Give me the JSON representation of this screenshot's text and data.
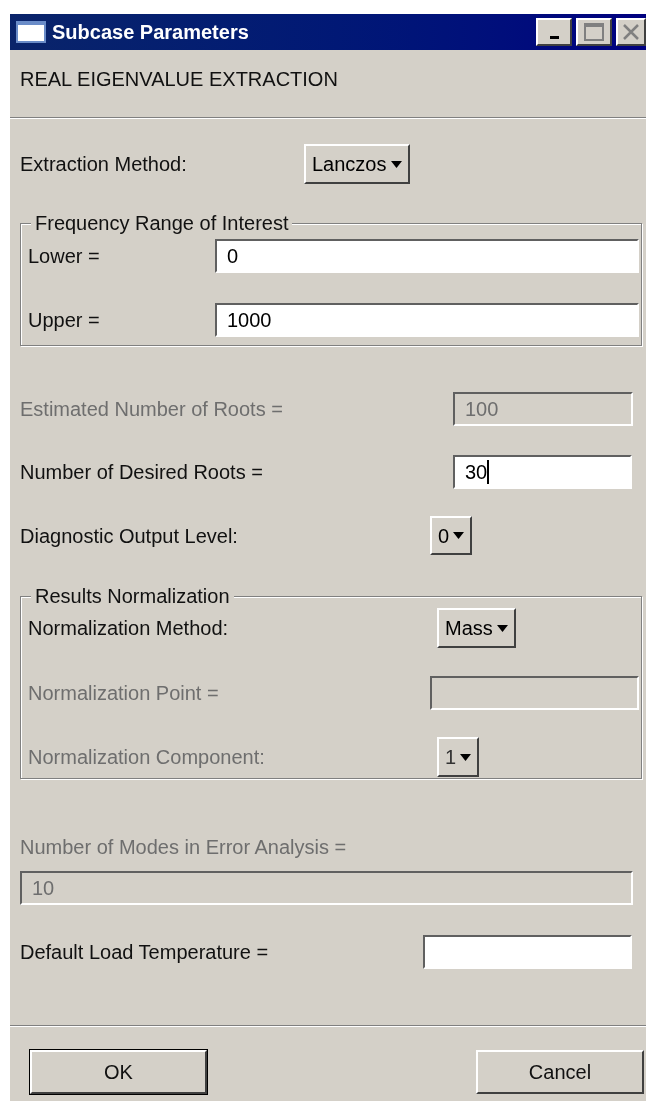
{
  "window": {
    "title": "Subcase Parameters"
  },
  "heading": "REAL EIGENVALUE EXTRACTION",
  "rows": [
    {
      "kind": "dropdown",
      "label": "Extraction Method:",
      "value": "Lanczos",
      "disabled": false
    },
    {
      "kind": "group",
      "title": "Frequency Range of Interest",
      "children": [
        {
          "kind": "field",
          "label": "Lower =",
          "value": "0",
          "disabled": false,
          "focused": false
        },
        {
          "kind": "field",
          "label": "Upper =",
          "value": "1000",
          "disabled": false,
          "focused": false
        }
      ]
    },
    {
      "kind": "field",
      "label": "Estimated Number of Roots =",
      "value": "100",
      "disabled": true,
      "focused": false
    },
    {
      "kind": "field",
      "label": "Number of Desired Roots =",
      "value": "30",
      "disabled": false,
      "focused": true
    },
    {
      "kind": "dropdown",
      "label": "Diagnostic Output Level:",
      "value": "0",
      "disabled": false
    },
    {
      "kind": "group",
      "title": "Results Normalization",
      "children": [
        {
          "kind": "dropdown",
          "label": "Normalization Method:",
          "value": "Mass",
          "disabled": false
        },
        {
          "kind": "field",
          "label": "Normalization Point =",
          "disabled": true,
          "focused": false
        },
        {
          "kind": "dropdown",
          "label": "Normalization Component:",
          "value": "1",
          "disabled": true
        }
      ]
    },
    {
      "kind": "stacked-field",
      "label": "Number of Modes in Error Analysis =",
      "value": "10",
      "disabled": true,
      "focused": false
    },
    {
      "kind": "field",
      "label": "Default Load Temperature =",
      "disabled": false,
      "focused": false
    }
  ],
  "buttons": [
    {
      "label": "OK",
      "default": true
    },
    {
      "label": "Cancel",
      "default": false
    }
  ]
}
